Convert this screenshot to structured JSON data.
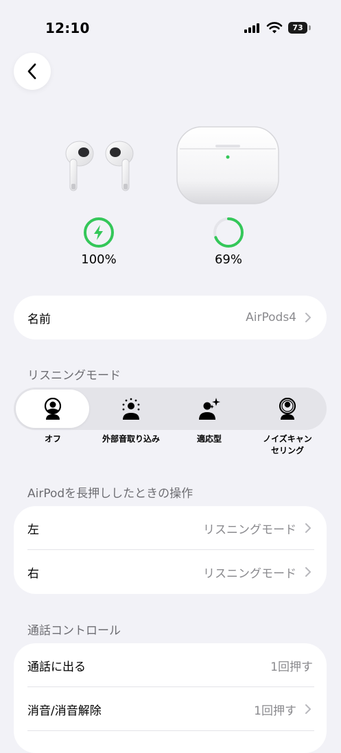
{
  "status_bar": {
    "time": "12:10",
    "battery_level": "73"
  },
  "devices": {
    "buds": {
      "battery_text": "100%",
      "charging": true,
      "level": 1.0
    },
    "case": {
      "battery_text": "69%",
      "charging": false,
      "level": 0.69
    }
  },
  "colors": {
    "accent_green": "#34c759",
    "background": "#f2f2f7",
    "secondary_text": "#8a8a8e"
  },
  "name_row": {
    "label": "名前",
    "value": "AirPods4"
  },
  "listening_mode": {
    "header": "リスニングモード",
    "modes": [
      {
        "label": "オフ",
        "icon": "person-off-icon",
        "selected": true
      },
      {
        "label": "外部音取り込み",
        "icon": "transparency-icon",
        "selected": false
      },
      {
        "label": "適応型",
        "icon": "adaptive-icon",
        "selected": false
      },
      {
        "label_line1": "ノイズキャン",
        "label_line2": "セリング",
        "icon": "noise-cancel-icon",
        "selected": false
      }
    ]
  },
  "press_hold": {
    "header": "AirPodを長押ししたときの操作",
    "rows": [
      {
        "label": "左",
        "value": "リスニングモード"
      },
      {
        "label": "右",
        "value": "リスニングモード"
      }
    ]
  },
  "call_controls": {
    "header": "通話コントロール",
    "rows": [
      {
        "label": "通話に出る",
        "value": "1回押す"
      },
      {
        "label": "消音/消音解除",
        "value": "1回押す"
      }
    ]
  }
}
